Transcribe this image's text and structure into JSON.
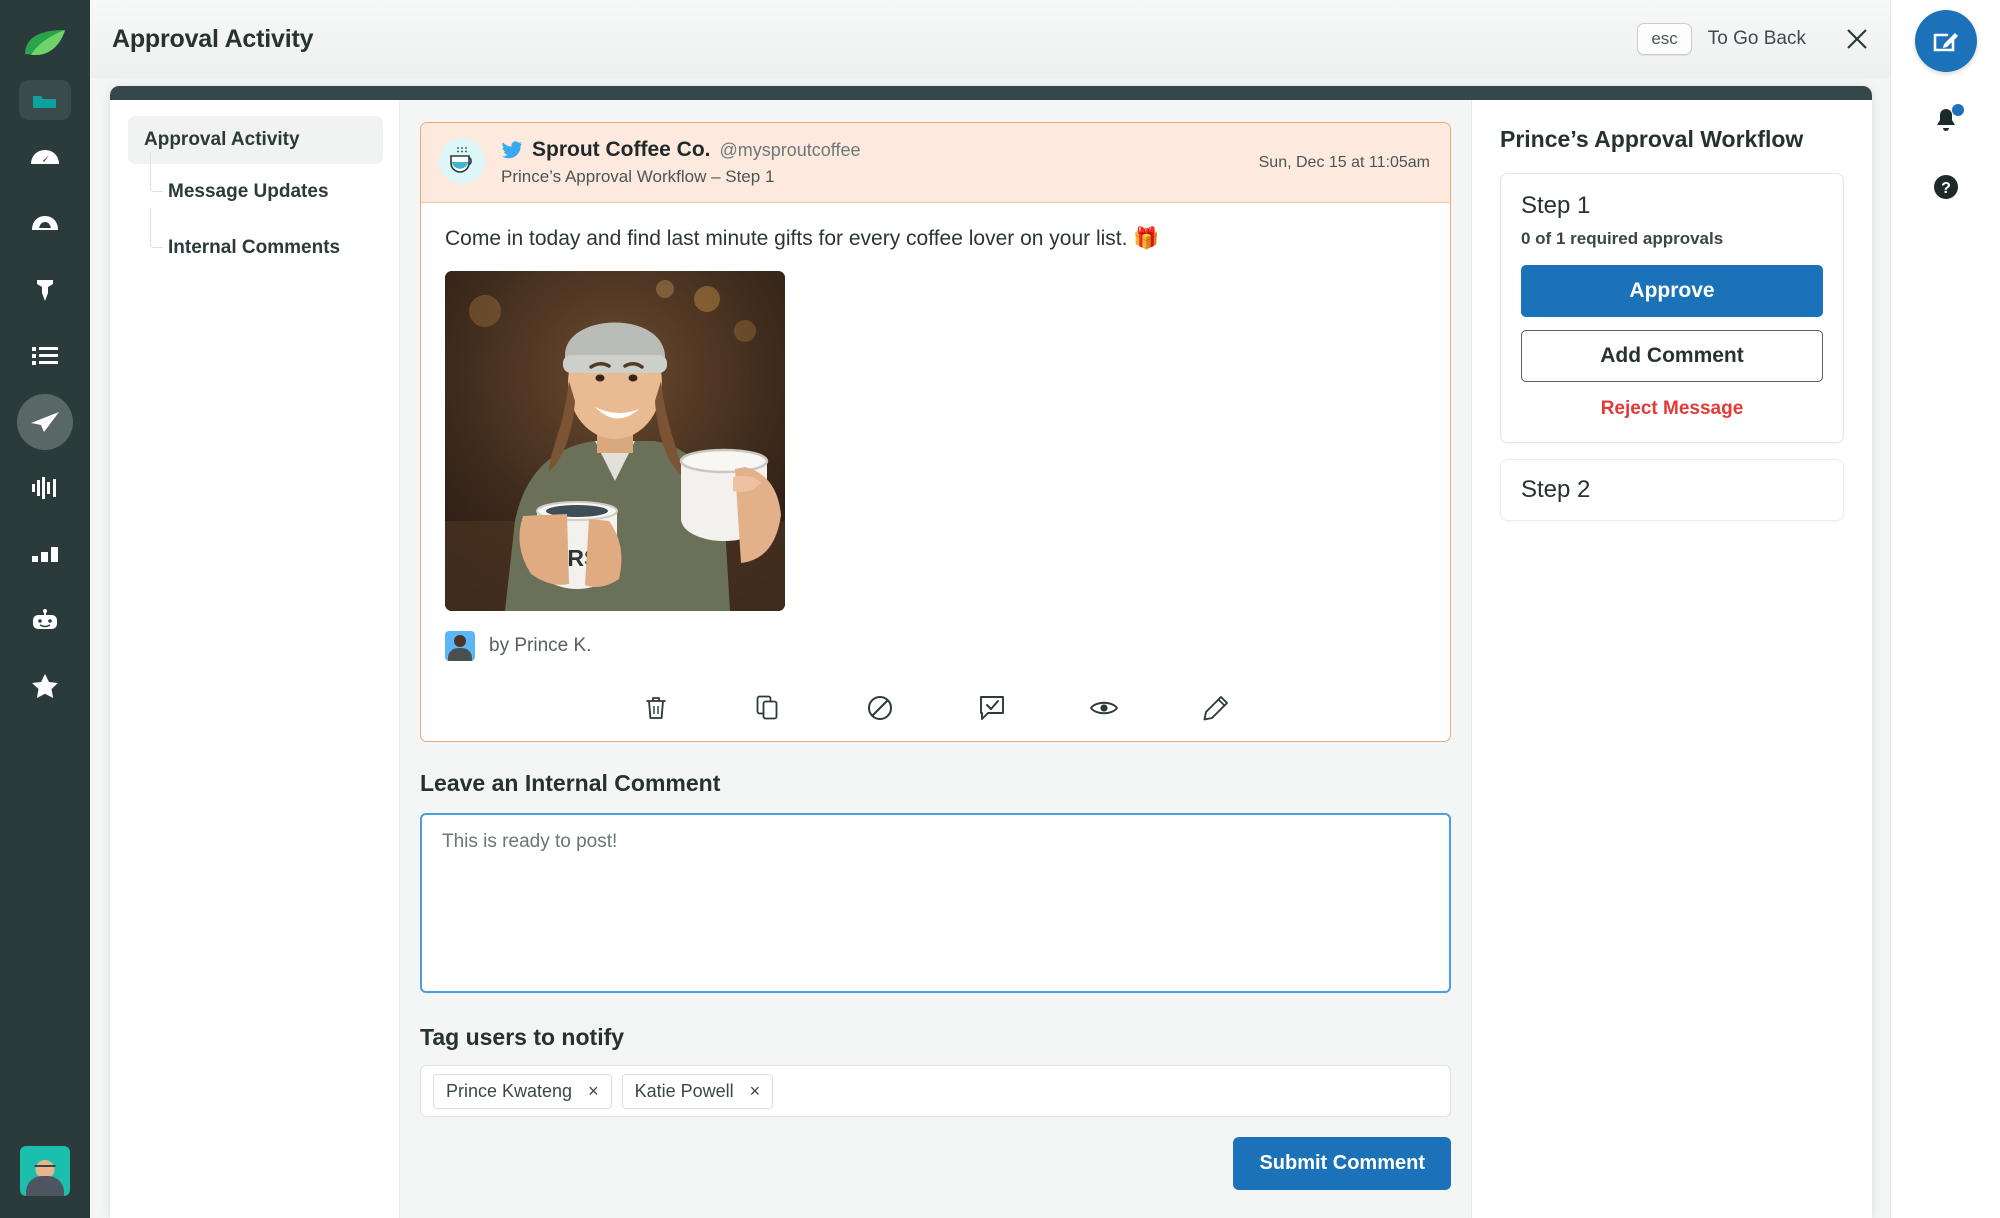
{
  "header": {
    "title": "Approval Activity",
    "esc_key": "esc",
    "go_back_label": "To Go Back"
  },
  "rail": {
    "items": [
      {
        "name": "sprout-logo",
        "icon": "leaf-icon"
      },
      {
        "name": "sidebar-item-inbox-folder",
        "icon": "folder-icon"
      },
      {
        "name": "sidebar-item-dashboard",
        "icon": "speedometer-icon"
      },
      {
        "name": "sidebar-item-smart-inbox",
        "icon": "inbox-icon"
      },
      {
        "name": "sidebar-item-pinned",
        "icon": "pin-icon"
      },
      {
        "name": "sidebar-item-tasks",
        "icon": "list-icon"
      },
      {
        "name": "sidebar-item-publishing",
        "icon": "paper-plane-icon"
      },
      {
        "name": "sidebar-item-listening",
        "icon": "waveform-icon"
      },
      {
        "name": "sidebar-item-reports",
        "icon": "bar-chart-icon"
      },
      {
        "name": "sidebar-item-bot",
        "icon": "robot-icon"
      },
      {
        "name": "sidebar-item-reviews",
        "icon": "star-icon"
      }
    ]
  },
  "util_rail": {
    "compose_icon": "compose-icon",
    "notifications_icon": "bell-icon",
    "help_icon": "help-circle-icon",
    "has_notification": true
  },
  "modal_nav": {
    "items": [
      {
        "label": "Approval Activity",
        "active": true
      },
      {
        "label": "Message Updates",
        "active": false
      },
      {
        "label": "Internal Comments",
        "active": false
      }
    ]
  },
  "message": {
    "network": "twitter",
    "brand_name": "Sprout Coffee Co.",
    "handle": "@mysproutcoffee",
    "workflow_step": "Prince’s Approval Workflow – Step 1",
    "timestamp": "Sun, Dec 15 at 11:05am",
    "text": "Come in today and find last minute gifts for every coffee lover on your list. 🎁",
    "author_prefix": "by Prince K.",
    "actions": [
      {
        "name": "delete-action",
        "icon": "trash-icon",
        "label": "Delete"
      },
      {
        "name": "duplicate-action",
        "icon": "copy-icon",
        "label": "Duplicate"
      },
      {
        "name": "block-action",
        "icon": "no-entry-icon",
        "label": "Block"
      },
      {
        "name": "approve-comment-action",
        "icon": "comment-check-icon",
        "label": "Comment"
      },
      {
        "name": "preview-action",
        "icon": "eye-icon",
        "label": "Preview"
      },
      {
        "name": "edit-action",
        "icon": "pencil-icon",
        "label": "Edit"
      }
    ]
  },
  "comment_section": {
    "title": "Leave an Internal Comment",
    "textarea_value": "This is ready to post!",
    "textarea_placeholder": "Leave an internal comment",
    "tag_title": "Tag users to notify",
    "tags": [
      "Prince Kwateng",
      "Katie Powell"
    ],
    "tag_remove_glyph": "×",
    "submit_label": "Submit Comment"
  },
  "workflow": {
    "title": "Prince’s Approval Workflow",
    "steps": [
      {
        "title": "Step 1",
        "subtitle": "0 of 1 required approvals",
        "approve_label": "Approve",
        "add_comment_label": "Add Comment",
        "reject_label": "Reject Message"
      },
      {
        "title": "Step 2"
      }
    ]
  },
  "colors": {
    "rail_bg": "#2b3b3b",
    "accent_blue": "#1b72b8",
    "reject_red": "#e23b36",
    "card_border_orange": "#f0a875",
    "card_head_bg": "#fde9dd",
    "sprout_green": "#59c36a",
    "twitter_blue": "#3ba9ee",
    "focus_blue": "#4a9ede"
  }
}
